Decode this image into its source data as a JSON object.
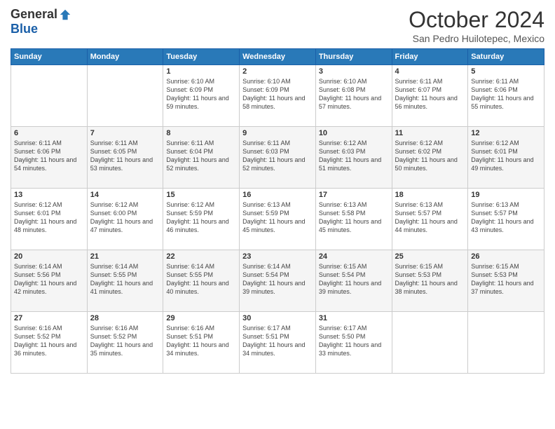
{
  "logo": {
    "general": "General",
    "blue": "Blue"
  },
  "title": "October 2024",
  "location": "San Pedro Huilotepec, Mexico",
  "days_of_week": [
    "Sunday",
    "Monday",
    "Tuesday",
    "Wednesday",
    "Thursday",
    "Friday",
    "Saturday"
  ],
  "weeks": [
    [
      {
        "day": "",
        "info": ""
      },
      {
        "day": "",
        "info": ""
      },
      {
        "day": "1",
        "info": "Sunrise: 6:10 AM\nSunset: 6:09 PM\nDaylight: 11 hours and 59 minutes."
      },
      {
        "day": "2",
        "info": "Sunrise: 6:10 AM\nSunset: 6:09 PM\nDaylight: 11 hours and 58 minutes."
      },
      {
        "day": "3",
        "info": "Sunrise: 6:10 AM\nSunset: 6:08 PM\nDaylight: 11 hours and 57 minutes."
      },
      {
        "day": "4",
        "info": "Sunrise: 6:11 AM\nSunset: 6:07 PM\nDaylight: 11 hours and 56 minutes."
      },
      {
        "day": "5",
        "info": "Sunrise: 6:11 AM\nSunset: 6:06 PM\nDaylight: 11 hours and 55 minutes."
      }
    ],
    [
      {
        "day": "6",
        "info": "Sunrise: 6:11 AM\nSunset: 6:06 PM\nDaylight: 11 hours and 54 minutes."
      },
      {
        "day": "7",
        "info": "Sunrise: 6:11 AM\nSunset: 6:05 PM\nDaylight: 11 hours and 53 minutes."
      },
      {
        "day": "8",
        "info": "Sunrise: 6:11 AM\nSunset: 6:04 PM\nDaylight: 11 hours and 52 minutes."
      },
      {
        "day": "9",
        "info": "Sunrise: 6:11 AM\nSunset: 6:03 PM\nDaylight: 11 hours and 52 minutes."
      },
      {
        "day": "10",
        "info": "Sunrise: 6:12 AM\nSunset: 6:03 PM\nDaylight: 11 hours and 51 minutes."
      },
      {
        "day": "11",
        "info": "Sunrise: 6:12 AM\nSunset: 6:02 PM\nDaylight: 11 hours and 50 minutes."
      },
      {
        "day": "12",
        "info": "Sunrise: 6:12 AM\nSunset: 6:01 PM\nDaylight: 11 hours and 49 minutes."
      }
    ],
    [
      {
        "day": "13",
        "info": "Sunrise: 6:12 AM\nSunset: 6:01 PM\nDaylight: 11 hours and 48 minutes."
      },
      {
        "day": "14",
        "info": "Sunrise: 6:12 AM\nSunset: 6:00 PM\nDaylight: 11 hours and 47 minutes."
      },
      {
        "day": "15",
        "info": "Sunrise: 6:12 AM\nSunset: 5:59 PM\nDaylight: 11 hours and 46 minutes."
      },
      {
        "day": "16",
        "info": "Sunrise: 6:13 AM\nSunset: 5:59 PM\nDaylight: 11 hours and 45 minutes."
      },
      {
        "day": "17",
        "info": "Sunrise: 6:13 AM\nSunset: 5:58 PM\nDaylight: 11 hours and 45 minutes."
      },
      {
        "day": "18",
        "info": "Sunrise: 6:13 AM\nSunset: 5:57 PM\nDaylight: 11 hours and 44 minutes."
      },
      {
        "day": "19",
        "info": "Sunrise: 6:13 AM\nSunset: 5:57 PM\nDaylight: 11 hours and 43 minutes."
      }
    ],
    [
      {
        "day": "20",
        "info": "Sunrise: 6:14 AM\nSunset: 5:56 PM\nDaylight: 11 hours and 42 minutes."
      },
      {
        "day": "21",
        "info": "Sunrise: 6:14 AM\nSunset: 5:55 PM\nDaylight: 11 hours and 41 minutes."
      },
      {
        "day": "22",
        "info": "Sunrise: 6:14 AM\nSunset: 5:55 PM\nDaylight: 11 hours and 40 minutes."
      },
      {
        "day": "23",
        "info": "Sunrise: 6:14 AM\nSunset: 5:54 PM\nDaylight: 11 hours and 39 minutes."
      },
      {
        "day": "24",
        "info": "Sunrise: 6:15 AM\nSunset: 5:54 PM\nDaylight: 11 hours and 39 minutes."
      },
      {
        "day": "25",
        "info": "Sunrise: 6:15 AM\nSunset: 5:53 PM\nDaylight: 11 hours and 38 minutes."
      },
      {
        "day": "26",
        "info": "Sunrise: 6:15 AM\nSunset: 5:53 PM\nDaylight: 11 hours and 37 minutes."
      }
    ],
    [
      {
        "day": "27",
        "info": "Sunrise: 6:16 AM\nSunset: 5:52 PM\nDaylight: 11 hours and 36 minutes."
      },
      {
        "day": "28",
        "info": "Sunrise: 6:16 AM\nSunset: 5:52 PM\nDaylight: 11 hours and 35 minutes."
      },
      {
        "day": "29",
        "info": "Sunrise: 6:16 AM\nSunset: 5:51 PM\nDaylight: 11 hours and 34 minutes."
      },
      {
        "day": "30",
        "info": "Sunrise: 6:17 AM\nSunset: 5:51 PM\nDaylight: 11 hours and 34 minutes."
      },
      {
        "day": "31",
        "info": "Sunrise: 6:17 AM\nSunset: 5:50 PM\nDaylight: 11 hours and 33 minutes."
      },
      {
        "day": "",
        "info": ""
      },
      {
        "day": "",
        "info": ""
      }
    ]
  ]
}
